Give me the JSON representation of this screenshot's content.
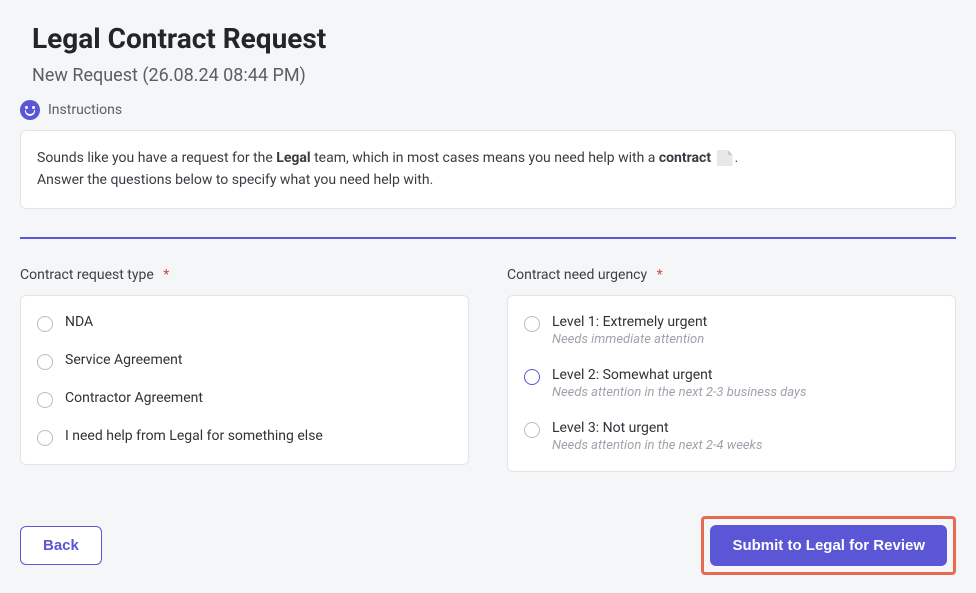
{
  "header": {
    "title": "Legal Contract Request",
    "subtitle": "New Request (26.08.24 08:44 PM)",
    "instructions_label": "Instructions"
  },
  "instructions": {
    "line1_a": "Sounds like you have a request for the ",
    "line1_b": "Legal",
    "line1_c": " team, which in most cases means you need help with a ",
    "line1_d": "contract",
    "line1_e": ".",
    "line2": "Answer the questions below to specify what you need help with."
  },
  "fields": {
    "contract_type": {
      "label": "Contract request type",
      "required_marker": "*",
      "options": [
        {
          "label": "NDA"
        },
        {
          "label": "Service Agreement"
        },
        {
          "label": "Contractor Agreement"
        },
        {
          "label": "I need help from Legal for something else"
        }
      ]
    },
    "urgency": {
      "label": "Contract need urgency",
      "required_marker": "*",
      "options": [
        {
          "label": "Level 1: Extremely urgent",
          "sub": "Needs immediate attention",
          "accent": false
        },
        {
          "label": "Level 2: Somewhat urgent",
          "sub": "Needs attention in the next 2-3 business days",
          "accent": true
        },
        {
          "label": "Level 3: Not urgent",
          "sub": "Needs attention in the next 2-4 weeks",
          "accent": false
        }
      ]
    }
  },
  "footer": {
    "back_label": "Back",
    "submit_label": "Submit to Legal for Review"
  }
}
